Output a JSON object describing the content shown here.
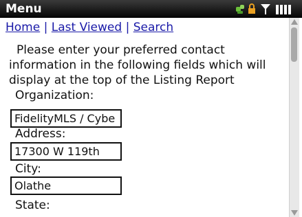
{
  "statusbar": {
    "title": "Menu",
    "icons": [
      "network-icon",
      "lock-icon",
      "antenna-icon",
      "signal-bars-icon"
    ]
  },
  "nav": {
    "home": "Home",
    "last_viewed": "Last Viewed",
    "search": "Search",
    "separator": "|"
  },
  "intro": {
    "line1": "Please enter your preferred contact",
    "line2": "information in the following fields which will",
    "line3": "display at the top of the Listing Report"
  },
  "form": {
    "organization_label": "Organization:",
    "organization_value": "FidelityMLS / Cybe",
    "address_label": "Address:",
    "address_value": "17300 W 119th",
    "city_label": "City:",
    "city_value": "Olathe",
    "state_label": "State:"
  },
  "colors": {
    "link": "#1a1aa8",
    "statusbar": "#0a0a0a"
  }
}
